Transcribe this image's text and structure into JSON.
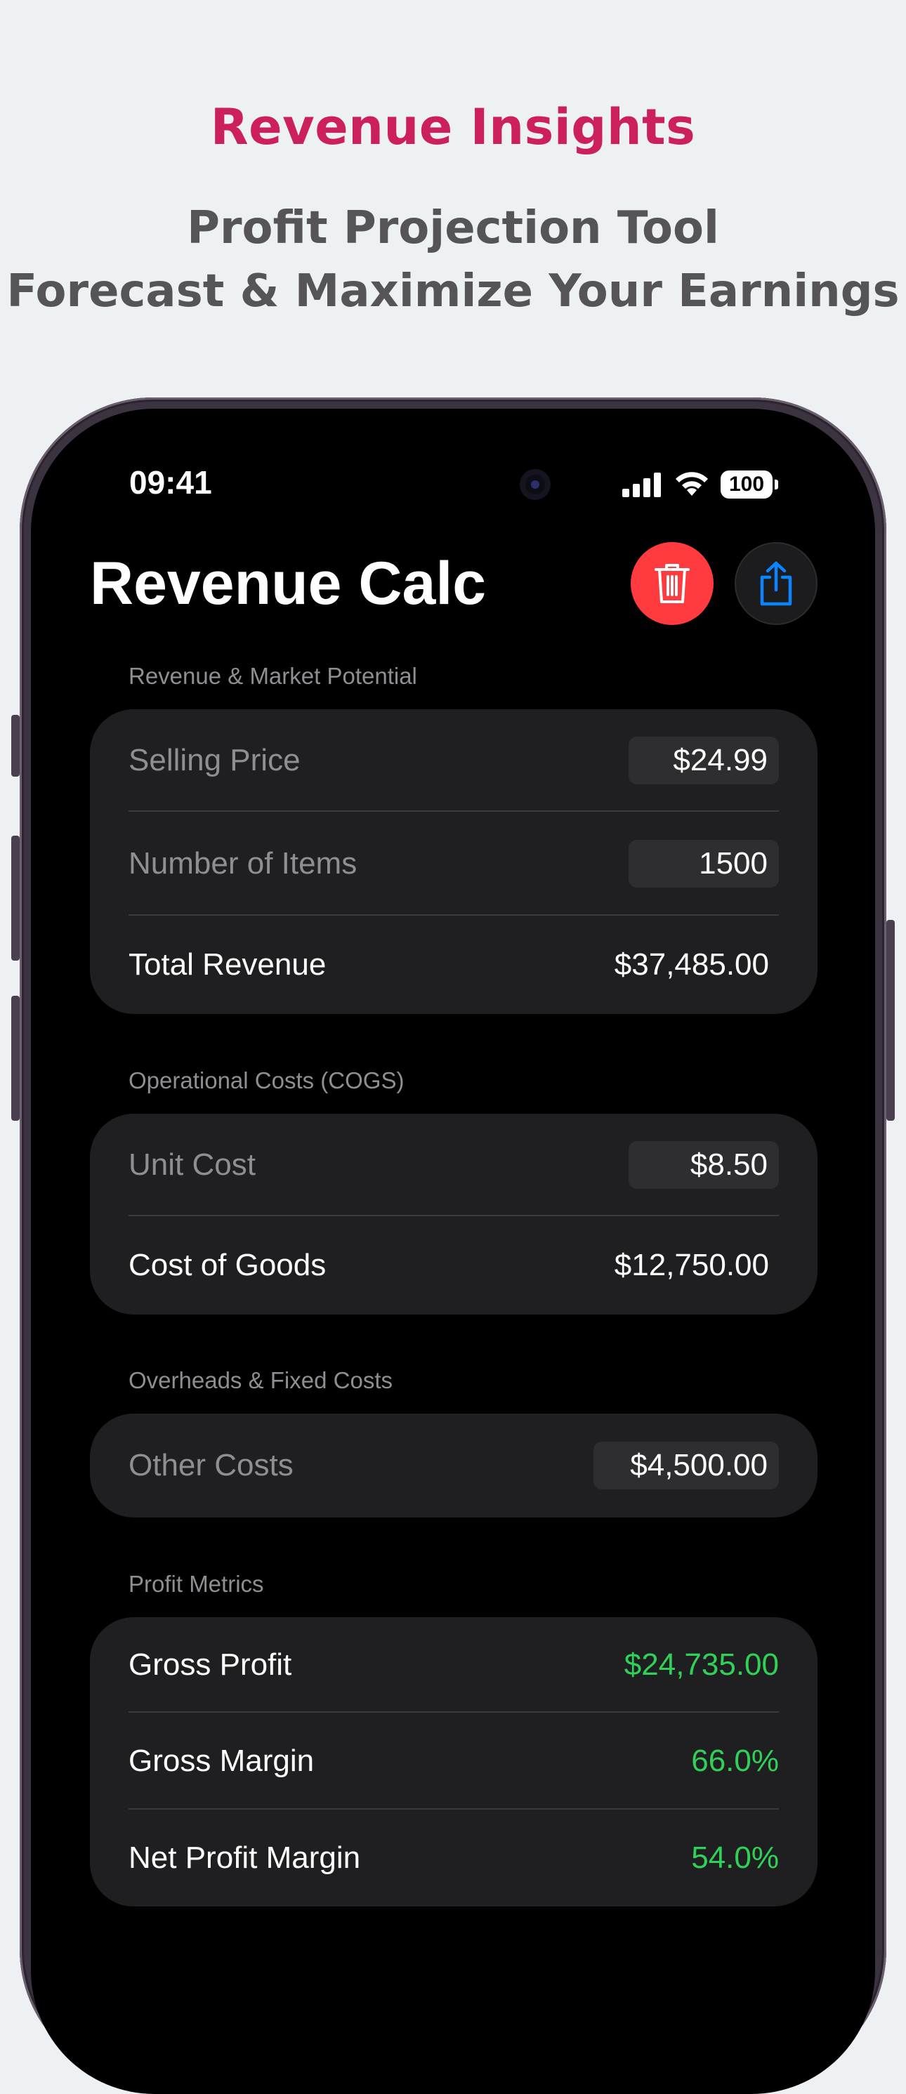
{
  "promo": {
    "title": "Revenue Insights",
    "subtitle_line1": "Profit Projection Tool",
    "subtitle_line2": "Forecast & Maximize Your Earnings"
  },
  "status_bar": {
    "time": "09:41",
    "battery": "100"
  },
  "app": {
    "title": "Revenue Calc",
    "icons": {
      "delete": "trash-icon",
      "share": "share-icon"
    },
    "colors": {
      "delete": "#ff3b3f",
      "share_icon": "#0a84ff",
      "positive": "#30d158",
      "promo_title": "#cc1f5d"
    }
  },
  "sections": {
    "revenue": {
      "label": "Revenue & Market Potential",
      "selling_price": {
        "label": "Selling Price",
        "value": "$24.99"
      },
      "number_of_items": {
        "label": "Number of Items",
        "value": "1500"
      },
      "total_revenue": {
        "label": "Total Revenue",
        "value": "$37,485.00"
      }
    },
    "cogs": {
      "label": "Operational Costs (COGS)",
      "unit_cost": {
        "label": "Unit Cost",
        "value": "$8.50"
      },
      "cost_of_goods": {
        "label": "Cost of Goods",
        "value": "$12,750.00"
      }
    },
    "overheads": {
      "label": "Overheads & Fixed Costs",
      "other_costs": {
        "label": "Other Costs",
        "value": "$4,500.00"
      }
    },
    "profit": {
      "label": "Profit Metrics",
      "gross_profit": {
        "label": "Gross Profit",
        "value": "$24,735.00"
      },
      "gross_margin": {
        "label": "Gross Margin",
        "value": "66.0%"
      },
      "net_profit_margin": {
        "label": "Net Profit Margin",
        "value": "54.0%"
      }
    }
  }
}
